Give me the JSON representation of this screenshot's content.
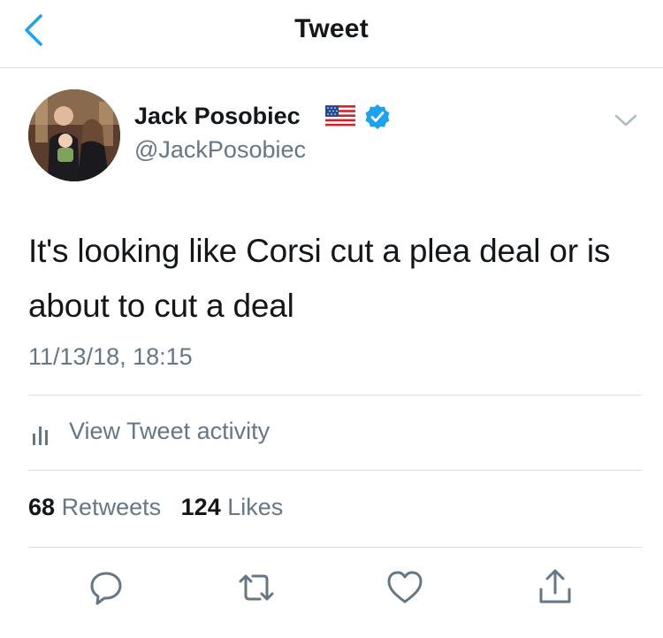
{
  "header": {
    "title": "Tweet",
    "back_icon": "chevron-left-icon"
  },
  "user": {
    "name": "Jack Posobiec",
    "handle": "@JackPosobiec",
    "flag_icon": "us-flag-icon",
    "verified_icon": "verified-badge-icon"
  },
  "tweet": {
    "text": "It's looking like Corsi cut a plea deal or is about to cut a deal",
    "timestamp": "11/13/18, 18:15"
  },
  "activity": {
    "label": "View Tweet activity",
    "icon": "bar-chart-icon"
  },
  "stats": {
    "retweets_count": "68",
    "retweets_label": "Retweets",
    "likes_count": "124",
    "likes_label": "Likes"
  },
  "actions": [
    "reply-icon",
    "retweet-icon",
    "like-icon",
    "share-icon"
  ],
  "colors": {
    "accent": "#1da1f2",
    "text": "#14171a",
    "secondary": "#657786",
    "divider": "#d8dde2"
  }
}
